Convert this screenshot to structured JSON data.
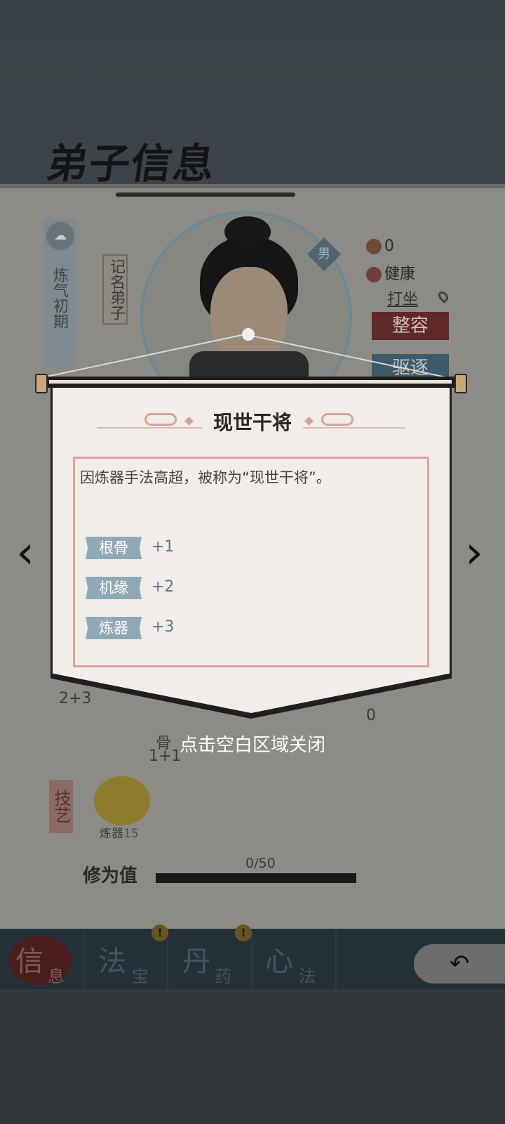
{
  "page": {
    "title": "弟子信息"
  },
  "profile": {
    "realm": "炼气初期",
    "rank_title": "记名弟子",
    "gender": "男",
    "mood_value": "0",
    "health": "健康",
    "activity": "打坐",
    "btn_makeover": "整容",
    "btn_expel": "驱逐"
  },
  "modal": {
    "title": "现世干将",
    "description": "因炼器手法高超，被称为“现世干将”。",
    "attributes": [
      {
        "name": "根骨",
        "value": "+1"
      },
      {
        "name": "机缘",
        "value": "+2"
      },
      {
        "name": "炼器",
        "value": "+3"
      }
    ],
    "close_hint": "点击空白区域关闭",
    "prev_icon": "chevron-left-icon",
    "next_icon": "chevron-right-icon"
  },
  "background_stats": {
    "left_value": "2+3",
    "right_value": "0",
    "bone_label": "骨",
    "bone_value": "1+1"
  },
  "skills": {
    "section_label": "技艺",
    "items": [
      {
        "name": "炼器",
        "level": "15"
      }
    ]
  },
  "cultivation": {
    "label": "修为值",
    "value": "0/50",
    "progress": 0
  },
  "tabs": [
    {
      "main": "信",
      "sub": "息",
      "active": true,
      "alert": false
    },
    {
      "main": "法",
      "sub": "宝",
      "active": false,
      "alert": true
    },
    {
      "main": "丹",
      "sub": "药",
      "active": false,
      "alert": true
    },
    {
      "main": "心",
      "sub": "法",
      "active": false,
      "alert": false
    }
  ],
  "alert_glyph": "!",
  "back_glyph": "↶"
}
